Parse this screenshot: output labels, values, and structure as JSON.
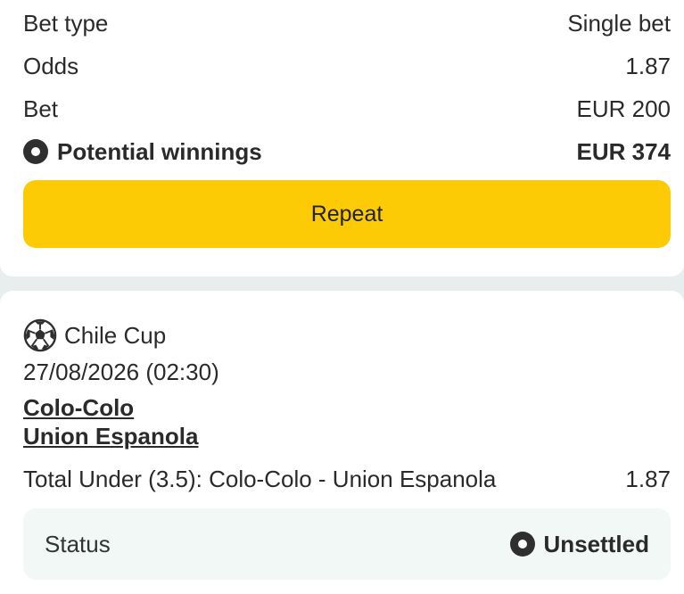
{
  "summary": {
    "bet_type_label": "Bet type",
    "bet_type_value": "Single bet",
    "odds_label": "Odds",
    "odds_value": "1.87",
    "bet_label": "Bet",
    "bet_value": "EUR 200",
    "potential_label": "Potential winnings",
    "potential_value": "EUR 374",
    "potential_icon": "radio-dot-icon"
  },
  "repeat_button": {
    "label": "Repeat",
    "color": "#fccb05"
  },
  "event": {
    "sport_icon": "soccer-ball-icon",
    "league": "Chile Cup",
    "datetime": "27/08/2026 (02:30)",
    "home_team": "Colo-Colo",
    "away_team": "Union Espanola",
    "market": "Total Under (3.5): Colo-Colo - Union Espanola",
    "odds": "1.87"
  },
  "status": {
    "label": "Status",
    "value": "Unsettled",
    "icon": "radio-dot-icon"
  }
}
